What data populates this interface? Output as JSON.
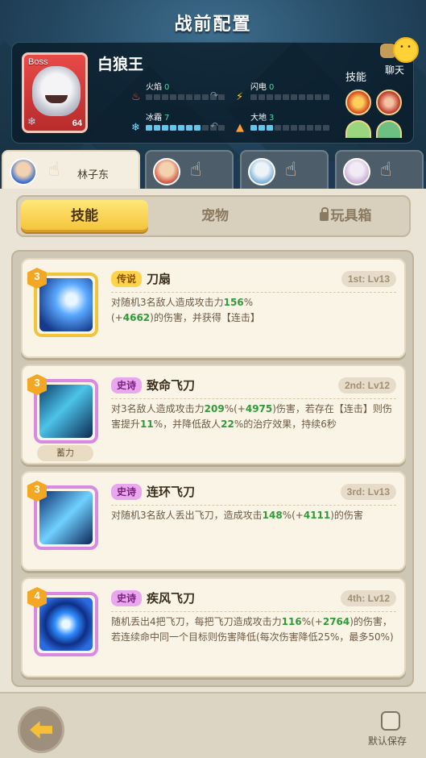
{
  "header": {
    "title": "战前配置"
  },
  "boss": {
    "tag": "Boss",
    "name": "白狼王",
    "level": "64",
    "stats": [
      {
        "label": "火焰",
        "value": "0",
        "fill": 0,
        "icon": "fire-icon"
      },
      {
        "label": "闪电",
        "value": "0",
        "fill": 0,
        "icon": "lightning-icon"
      },
      {
        "label": "冰霜",
        "value": "7",
        "fill": 7,
        "icon": "frost-icon"
      },
      {
        "label": "大地",
        "value": "3",
        "fill": 3,
        "icon": "earth-icon"
      }
    ],
    "skills_label": "技能"
  },
  "chat": {
    "label": "聊天"
  },
  "heroes": [
    {
      "name": "林子东",
      "active": true,
      "color": "#3a6fd0"
    },
    {
      "name": "",
      "active": false,
      "color": "#d65a48"
    },
    {
      "name": "",
      "active": false,
      "color": "#7fb3d8"
    },
    {
      "name": "",
      "active": false,
      "color": "#c9b0d8"
    }
  ],
  "mode_tabs": [
    {
      "label": "技能",
      "active": true
    },
    {
      "label": "宠物",
      "active": false
    },
    {
      "label": "玩具箱",
      "active": false,
      "locked": true
    }
  ],
  "skills": [
    {
      "badge": "3",
      "rarity": "传说",
      "rarity_type": "legend",
      "name": "刀扇",
      "slot": "1st: Lv13",
      "desc": "对随机3名敌人造成攻击力<span class='n'>156</span>%(+<span class='n'>4662</span>)的伤害，并获得【连击】",
      "sub": ""
    },
    {
      "badge": "3",
      "rarity": "史诗",
      "rarity_type": "epic",
      "name": "致命飞刀",
      "slot": "2nd: Lv12",
      "desc": "对3名敌人造成攻击力<span class='n'>209</span>%(+<span class='n'>4975</span>)伤害，若存在【连击】则伤害提升<span class='n'>11</span>%，并降低敌人<span class='n'>22</span>%的治疗效果，持续6秒",
      "sub": "蓄力"
    },
    {
      "badge": "3",
      "rarity": "史诗",
      "rarity_type": "epic",
      "name": "连环飞刀",
      "slot": "3rd: Lv13",
      "desc": "对随机3名敌人丢出飞刀，造成攻击<span class='n'>148</span>%(+<span class='n'>4111</span>)的伤害",
      "sub": ""
    },
    {
      "badge": "4",
      "rarity": "史诗",
      "rarity_type": "epic",
      "name": "疾风飞刀",
      "slot": "4th: Lv12",
      "desc": "随机丢出4把飞刀，每把飞刀造成攻击力<span class='n'>116</span>%(+<span class='n'>2764</span>)的伤害，若连续命中同一个目标则伤害降低(每次伤害降低25%，最多50%)",
      "sub": ""
    }
  ],
  "footer": {
    "save_label": "默认保存"
  },
  "colors": {
    "legend_border": "#f2c43a",
    "epic_border": "#d98ae0",
    "accent_green": "#2f9b38"
  }
}
